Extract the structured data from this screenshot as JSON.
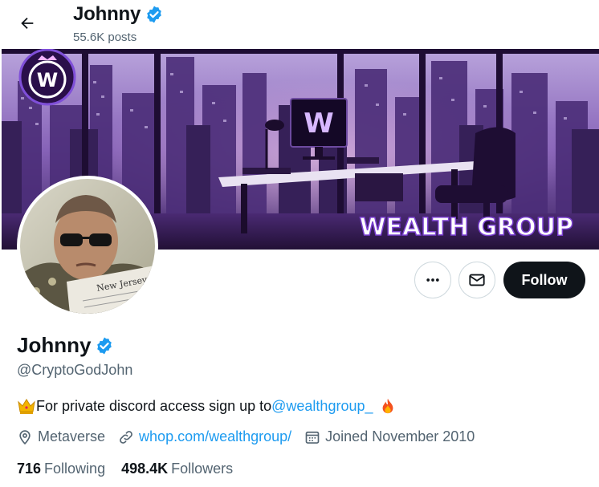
{
  "header": {
    "name": "Johnny",
    "posts": "55.6K posts"
  },
  "banner": {
    "brand_text": "WEALTH GROUP",
    "logo_letter": "W"
  },
  "avatar": {
    "newspaper_text": "New Jersey"
  },
  "actions": {
    "follow_label": "Follow"
  },
  "profile": {
    "name": "Johnny",
    "handle": "@CryptoGodJohn",
    "bio_text": "For private discord access sign up to ",
    "bio_mention": "@wealthgroup_",
    "location": "Metaverse",
    "website": "whop.com/wealthgroup/",
    "joined": "Joined November 2010",
    "following_count": "716",
    "following_label": "Following",
    "followers_count": "498.4K",
    "followers_label": "Followers"
  },
  "colors": {
    "accent": "#1d9bf0",
    "text": "#0f1419",
    "secondary": "#536471",
    "follow_bg": "#0f1419"
  }
}
